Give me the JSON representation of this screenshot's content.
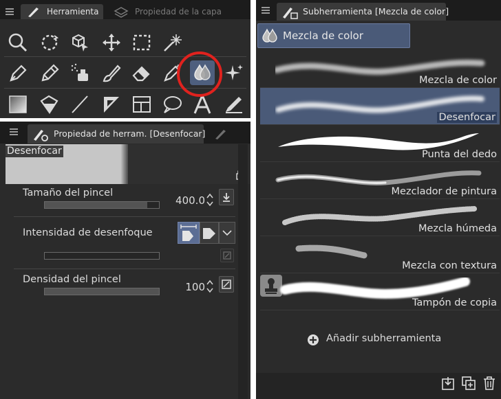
{
  "tool_panel": {
    "tabs": [
      {
        "label": "Herramienta",
        "active": true
      },
      {
        "label": "Propiedad de la capa",
        "active": false
      }
    ],
    "rows": [
      [
        "zoom-icon",
        "rotate-icon",
        "object-icon",
        "move-icon",
        "selection-icon",
        "auto-select-icon"
      ],
      [
        "pen-icon",
        "pencil-icon",
        "airbrush-icon",
        "brush-icon",
        "eraser-icon",
        "decoration-icon",
        "blend-icon",
        "sparkle-icon"
      ],
      [
        "gradient-icon",
        "fill-icon",
        "line-icon",
        "ruler-icon",
        "frame-icon",
        "balloon-icon",
        "text-icon",
        "correct-line-icon"
      ]
    ],
    "selected_tool": "blend-icon",
    "highlight_color": "#e0221e"
  },
  "property_panel": {
    "title": "Propiedad de herram. [Desenfocar]",
    "preview_label": "Desenfocar",
    "rows": [
      {
        "label": "Tamaño del pincel",
        "value": "400.0",
        "fill": 0.9
      },
      {
        "label": "Intensidad de desenfoque",
        "value": "",
        "fill": 0.0
      },
      {
        "label": "Densidad del pincel",
        "value": "100",
        "fill": 1.0
      }
    ]
  },
  "subtool_panel": {
    "title": "Subherramienta [Mezcla de color]",
    "group_label": "Mezcla de color",
    "items": [
      {
        "label": "Mezcla de color",
        "selected": false
      },
      {
        "label": "Desenfocar",
        "selected": true
      },
      {
        "label": "Punta del dedo",
        "selected": false
      },
      {
        "label": "Mezclador de pintura",
        "selected": false
      },
      {
        "label": "Mezcla húmeda",
        "selected": false
      },
      {
        "label": "Mezcla con textura",
        "selected": false
      },
      {
        "label": "Tampón de copia",
        "selected": false
      }
    ],
    "add_label": "Añadir subherramienta"
  },
  "colors": {
    "panel_bg": "#2b2b2b",
    "selection_blue": "#4a5a78",
    "highlight_circle": "#e0221e"
  }
}
